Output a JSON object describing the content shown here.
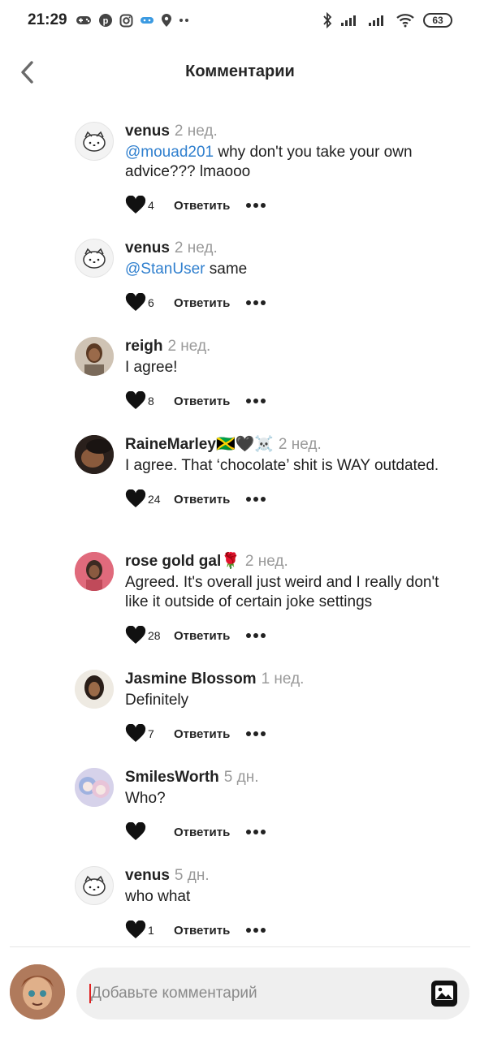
{
  "status": {
    "time": "21:29",
    "battery": "63"
  },
  "header": {
    "title": "Комментарии"
  },
  "comments": [
    {
      "username": "venus",
      "time": "2 нед.",
      "mention": "@mouad201",
      "text": " why don't you take your own advice??? lmaooo",
      "likes": "4",
      "reply": "Ответить"
    },
    {
      "username": "venus",
      "time": "2 нед.",
      "mention": "@StanUser",
      "text": " same",
      "likes": "6",
      "reply": "Ответить"
    },
    {
      "username": "reigh",
      "time": "2 нед.",
      "mention": "",
      "text": "I agree!",
      "likes": "8",
      "reply": "Ответить"
    },
    {
      "username": "RaineMarley🇯🇲🖤☠️",
      "time": "2 нед.",
      "mention": "",
      "text": "I agree. That ‘chocolate’ shit is WAY outdated.",
      "likes": "24",
      "reply": "Ответить"
    },
    {
      "username": "rose gold gal🌹",
      "time": "2 нед.",
      "mention": "",
      "text": "Agreed. It's overall just weird and I really don't like it outside of certain joke settings",
      "likes": "28",
      "reply": "Ответить"
    },
    {
      "username": "Jasmine Blossom",
      "time": "1 нед.",
      "mention": "",
      "text": "Definitely",
      "likes": "7",
      "reply": "Ответить"
    },
    {
      "username": "SmilesWorth",
      "time": "5 дн.",
      "mention": "",
      "text": "Who?",
      "likes": "",
      "reply": "Ответить"
    },
    {
      "username": "venus",
      "time": "5 дн.",
      "mention": "",
      "text": "who what",
      "likes": "1",
      "reply": "Ответить"
    }
  ],
  "composer": {
    "placeholder": "Добавьте комментарий"
  },
  "icons": {
    "back": "chevron-left-icon",
    "like": "heart-icon",
    "more": "more-dots-icon",
    "image": "image-icon"
  },
  "colors": {
    "mention": "#2f7fce",
    "time": "#9a9a9a",
    "caret": "#e02020"
  }
}
